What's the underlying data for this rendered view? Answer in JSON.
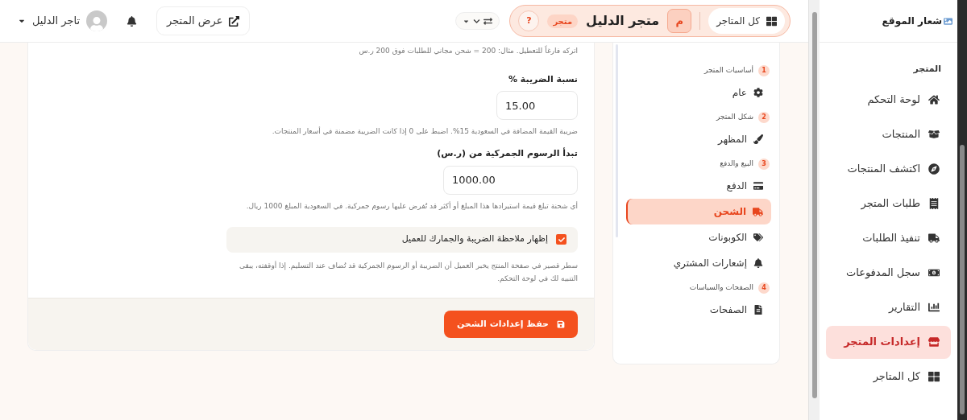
{
  "header": {
    "store_switcher": {
      "all_stores": "كل المتاجر",
      "store_initial": "م",
      "store_name": "متجر الدليل",
      "badge": "متجر",
      "help": "?"
    },
    "view_store": "عرض المتجر",
    "user": {
      "name": "تاجر الدليل"
    }
  },
  "sidebar": {
    "logo": "شعار الموقع",
    "section": "المتجر",
    "items": [
      {
        "label": "لوحة التحكم",
        "selected": false
      },
      {
        "label": "المنتجات",
        "selected": false
      },
      {
        "label": "اكتشف المنتجات",
        "selected": false
      },
      {
        "label": "طلبات المتجر",
        "selected": false
      },
      {
        "label": "تنفيذ الطلبات",
        "selected": false
      },
      {
        "label": "سجل المدفوعات",
        "selected": false
      },
      {
        "label": "التقارير",
        "selected": false
      },
      {
        "label": "إعدادات المتجر",
        "selected": true
      },
      {
        "label": "كل المتاجر",
        "selected": false
      }
    ]
  },
  "settings_nav": {
    "groups": [
      {
        "number": "1",
        "title": "أساسيات المتجر",
        "items": [
          {
            "label": "عام",
            "selected": false
          }
        ]
      },
      {
        "number": "2",
        "title": "شكل المتجر",
        "items": [
          {
            "label": "المظهر",
            "selected": false
          }
        ]
      },
      {
        "number": "3",
        "title": "البيع والدفع",
        "items": [
          {
            "label": "الدفع",
            "selected": false
          },
          {
            "label": "الشحن",
            "selected": true
          },
          {
            "label": "الكوبونات",
            "selected": false
          },
          {
            "label": "إشعارات المشتري",
            "selected": false
          }
        ]
      },
      {
        "number": "4",
        "title": "الصفحات والسياسات",
        "items": [
          {
            "label": "الصفحات",
            "selected": false
          }
        ]
      }
    ]
  },
  "form": {
    "top_hint": "اتركه فارغاً للتعطيل. مثال: 200 = شحن مجاني للطلبات فوق 200 ر.س",
    "fields": [
      {
        "label": "نسبة الضريبة %",
        "value": "15.00",
        "hint": "ضريبة القيمة المضافة في السعودية 15%. اضبط على 0 إذا كانت الضريبة مضمنة في أسعار المنتجات."
      },
      {
        "label": "تبدأ الرسوم الجمركية من (ر.س)",
        "value": "1000.00",
        "hint": "أي شحنة تبلغ قيمة استيرادها هذا المبلغ أو أكثر قد تُفرض عليها رسوم جمركية. في السعودية المبلغ 1000 ريال."
      }
    ],
    "checkbox": {
      "label": "إظهار ملاحظة الضريبة والجمارك للعميل",
      "checked": true,
      "hint": "سطر قصير في صفحة المنتج يخبر العميل أن الضريبة أو الرسوم الجمركية قد تُضاف عند التسليم. إذا أوقفته، يبقى التنبيه لك في لوحة التحكم."
    },
    "save_button": "حفظ إعدادات الشحن"
  }
}
